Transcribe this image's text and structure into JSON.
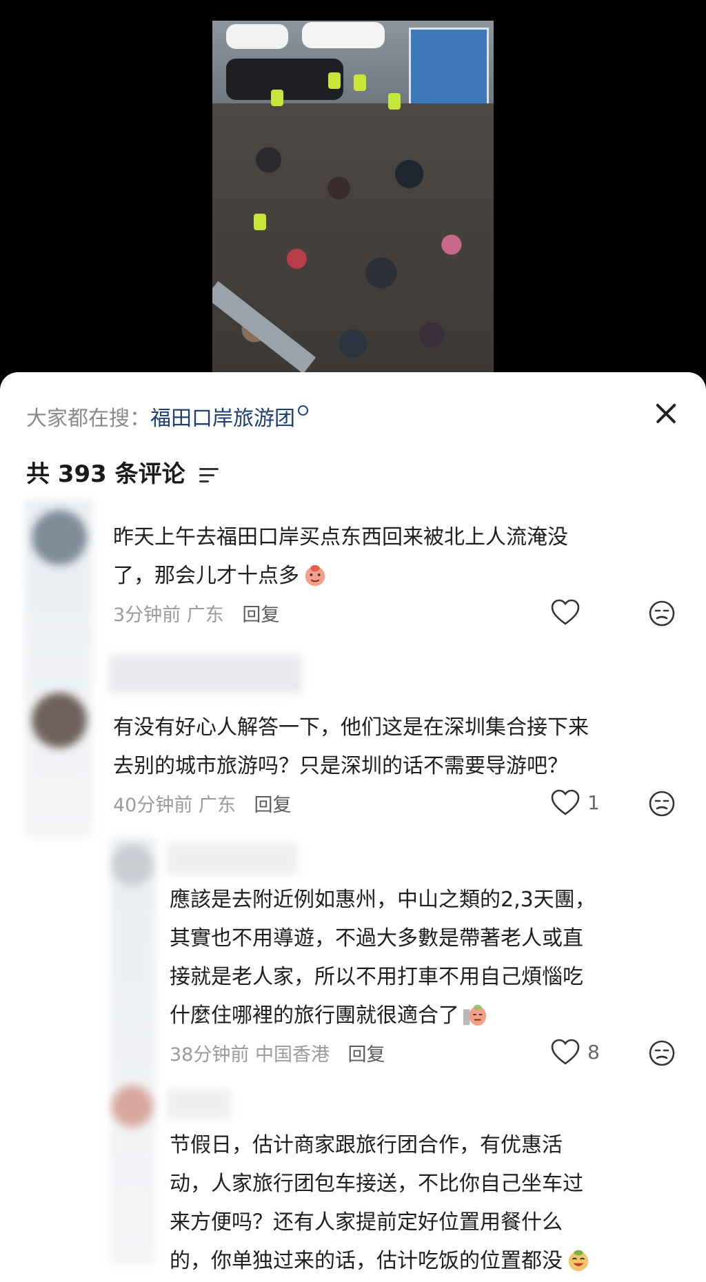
{
  "search": {
    "prefix": "大家都在搜：",
    "keyword": "福田口岸旅游团"
  },
  "comments_header": {
    "count_label": "共 393 条评论"
  },
  "comments": [
    {
      "lines": [
        "昨天上午去福田口岸买点东西回来被北上人流淹没",
        "了，那会儿才十点多"
      ],
      "time": "3分钟前",
      "location": "广东",
      "reply_label": "回复",
      "likes": ""
    },
    {
      "lines": [
        "有没有好心人解答一下，他们这是在深圳集合接下来",
        "去别的城市旅游吗？只是深圳的话不需要导游吧？"
      ],
      "time": "40分钟前",
      "location": "广东",
      "reply_label": "回复",
      "likes": "1"
    },
    {
      "lines": [
        "應該是去附近例如惠州，中山之類的2,3天團，",
        "其實也不用導遊，不過大多數是帶著老人或直",
        "接就是老人家，所以不用打車不用自己煩惱吃",
        "什麼住哪裡的旅行團就很適合了"
      ],
      "time": "38分钟前",
      "location": "中国香港",
      "reply_label": "回复",
      "likes": "8"
    },
    {
      "lines": [
        "节假日，估计商家跟旅行团合作，有优惠活",
        "动，人家旅行团包车接送，不比你自己坐车过",
        "来方便吗？还有人家提前定好位置用餐什么",
        "的，你单独过来的话，估计吃饭的位置都没"
      ]
    }
  ],
  "colors": {
    "keyword": "#1f3f73",
    "meta": "#9a9a9a",
    "sheet_bg": "#ffffff",
    "page_bg": "#000000"
  }
}
